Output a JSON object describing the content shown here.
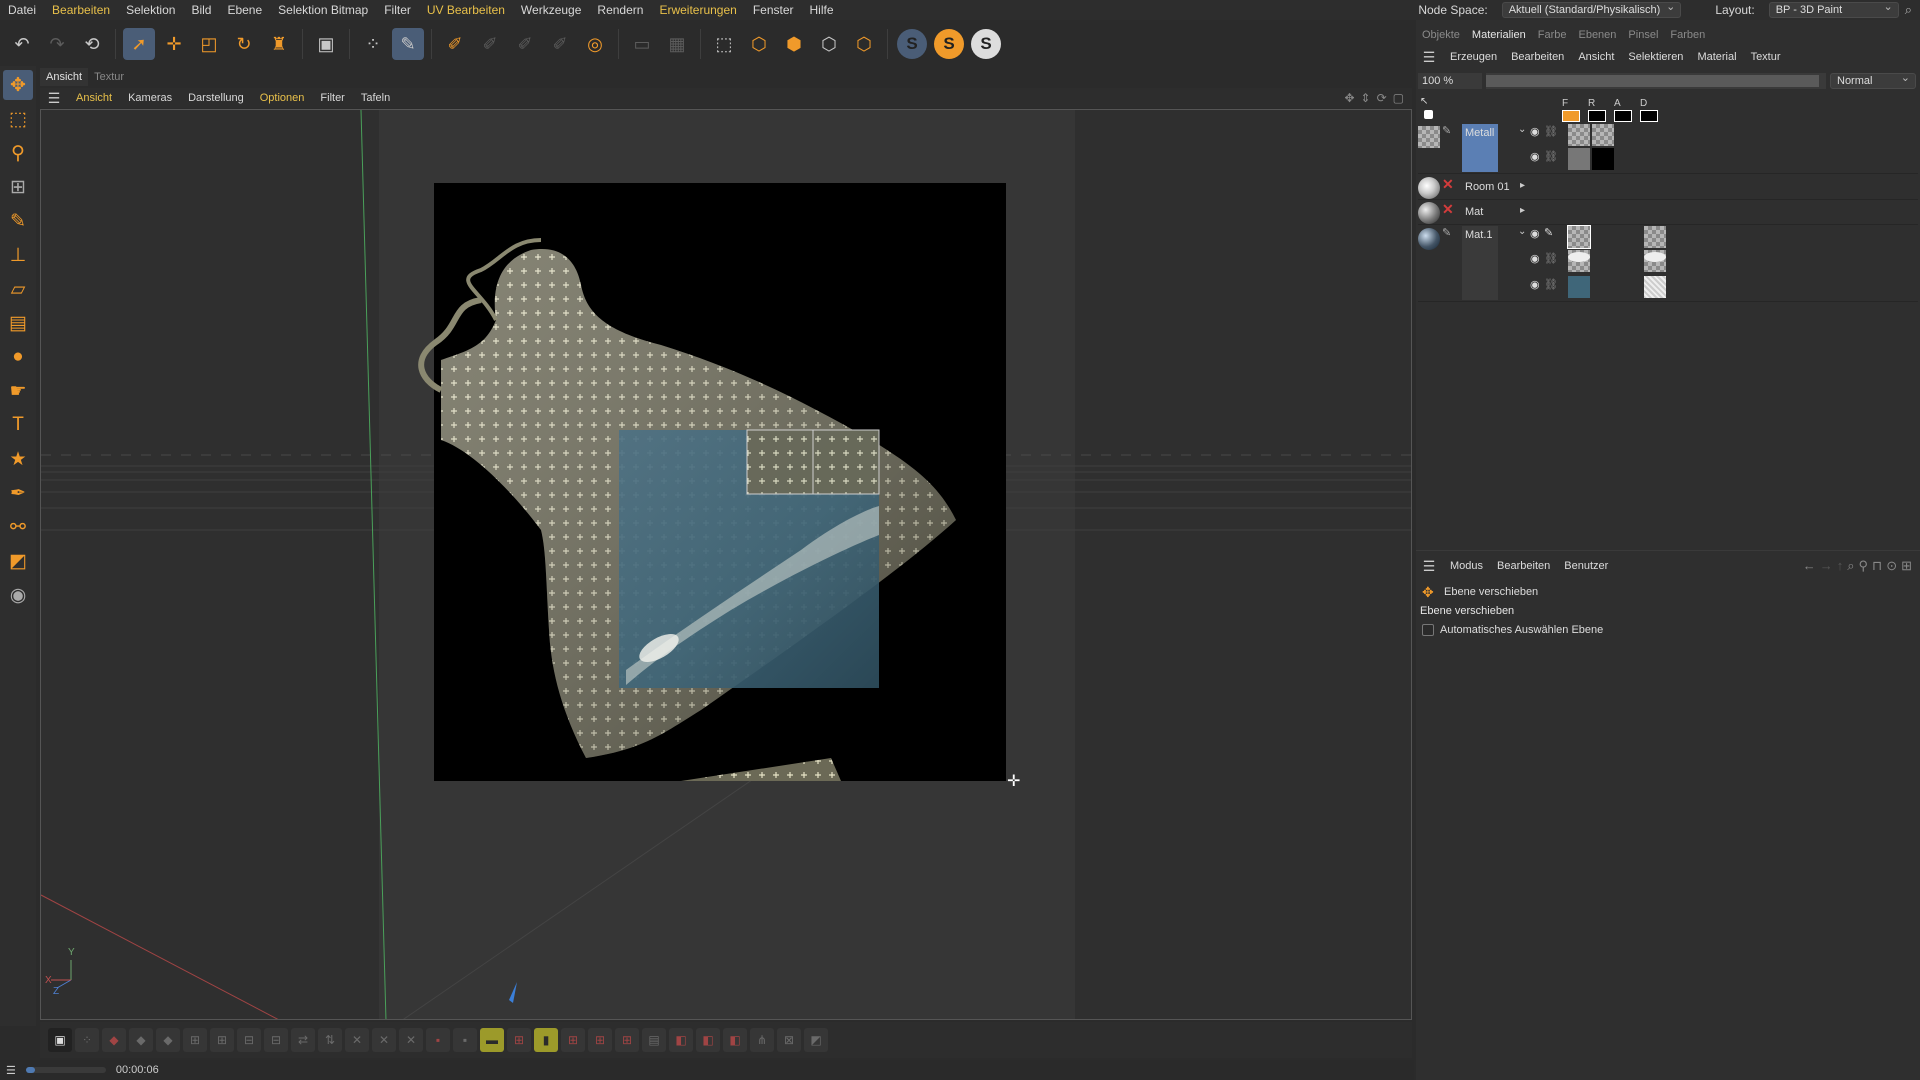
{
  "menubar": {
    "items": [
      "Datei",
      "Bearbeiten",
      "Selektion",
      "Bild",
      "Ebene",
      "Selektion Bitmap",
      "Filter",
      "UV Bearbeiten",
      "Werkzeuge",
      "Rendern",
      "Erweiterungen",
      "Fenster",
      "Hilfe"
    ],
    "highlighted": [
      "Bearbeiten",
      "UV Bearbeiten",
      "Erweiterungen"
    ],
    "node_space_label": "Node Space:",
    "node_space_value": "Aktuell (Standard/Physikalisch)",
    "layout_label": "Layout:",
    "layout_value": "BP - 3D Paint"
  },
  "toolbar": {
    "icons": [
      "undo-icon",
      "redo-icon",
      "uv-undo-icon",
      "select-pointer-icon",
      "move-icon",
      "scale-icon",
      "rotate-icon",
      "paint-stroke-icon",
      "render-region-icon",
      "uv-points-icon",
      "paint-3d-mode-icon",
      "paint-brush-icon",
      "paint-brush-2-icon",
      "paint-brush-3-icon",
      "paint-brush-4-icon",
      "render-icon",
      "canvas-icon",
      "canvas-2-icon",
      "projection-icon",
      "box-icon",
      "box-orange-icon",
      "box-2-icon",
      "box-3-icon",
      "sculpt-s-blue-icon",
      "sculpt-s-orange-icon",
      "sculpt-s-white-icon"
    ]
  },
  "lefttools": {
    "icons": [
      "move-tool-icon",
      "rect-select-icon",
      "magic-wand-icon",
      "transform-icon",
      "brush-icon",
      "stamp-icon",
      "eraser-icon",
      "gradient-icon",
      "drop-icon",
      "smudge-icon",
      "text-icon",
      "shape-icon",
      "eyedropper-icon",
      "clone-icon",
      "color-swatch-icon",
      "layer-mask-icon"
    ]
  },
  "viewport": {
    "tabs": [
      "Ansicht",
      "Textur"
    ],
    "active_tab": "Ansicht",
    "menu": [
      "Ansicht",
      "Kameras",
      "Darstellung",
      "Optionen",
      "Filter",
      "Tafeln"
    ],
    "menu_highlighted": [
      "Ansicht",
      "Optionen"
    ],
    "axis_y": "Y",
    "axis_x": "X",
    "axis_z": "Z"
  },
  "statusbar": {
    "time": "00:00:06",
    "progress": 0.12
  },
  "right_panel": {
    "tabs": [
      "Objekte",
      "Materialien",
      "Farbe",
      "Ebenen",
      "Pinsel",
      "Farben"
    ],
    "active_tab": "Materialien",
    "menu": [
      "Erzeugen",
      "Bearbeiten",
      "Ansicht",
      "Selektieren",
      "Material",
      "Textur"
    ],
    "zoom": "100 %",
    "blend_mode": "Normal",
    "channel_headers": [
      "F",
      "R",
      "A",
      "D"
    ],
    "materials": [
      {
        "name": "Metall",
        "selected": true
      },
      {
        "name": "Room 01",
        "selected": false
      },
      {
        "name": "Mat",
        "selected": false
      },
      {
        "name": "Mat.1",
        "selected": false
      }
    ]
  },
  "attributes": {
    "menu": [
      "Modus",
      "Bearbeiten",
      "Benutzer"
    ],
    "tool_name": "Ebene verschieben",
    "section_title": "Ebene verschieben",
    "checkbox_label": "Automatisches Auswählen Ebene",
    "checkbox_checked": false
  },
  "colors": {
    "accent_orange": "#f09a2a",
    "highlight_yellow": "#e8c04a",
    "selection_blue": "#4a5d77",
    "material_blue": "#5b7fb4"
  }
}
